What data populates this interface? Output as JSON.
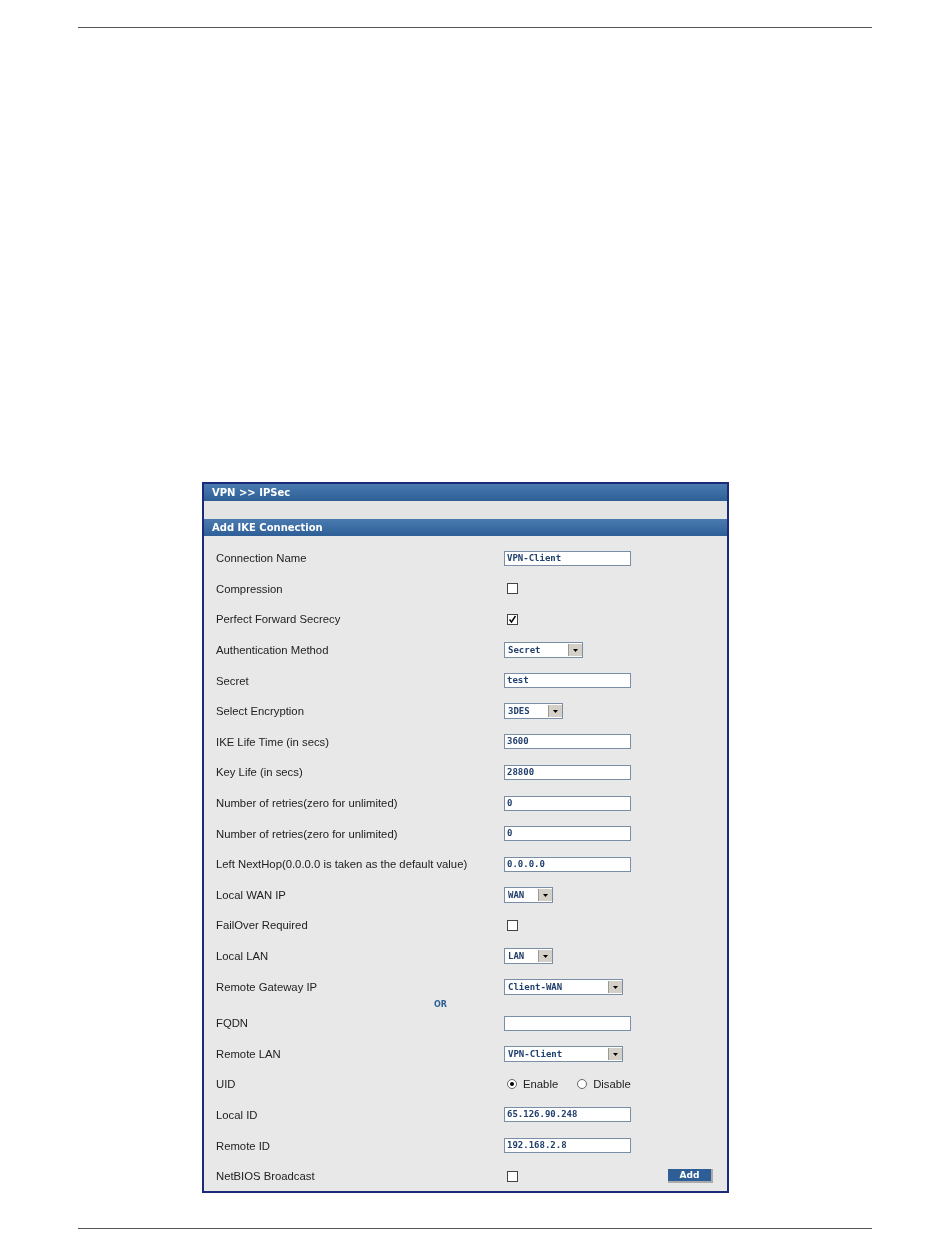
{
  "breadcrumb": "VPN >> IPSec",
  "section_title": "Add IKE Connection",
  "fields": [
    {
      "kind": "text",
      "label": "Connection Name",
      "value": "VPN-Client"
    },
    {
      "kind": "checkbox",
      "label": "Compression",
      "checked": false
    },
    {
      "kind": "checkbox",
      "label": "Perfect Forward Secrecy",
      "checked": true
    },
    {
      "kind": "select",
      "label": "Authentication Method",
      "value": "Secret"
    },
    {
      "kind": "text",
      "label": "Secret",
      "value": "test"
    },
    {
      "kind": "select",
      "label": "Select Encryption",
      "value": "3DES"
    },
    {
      "kind": "text",
      "label": "IKE Life Time (in secs)",
      "value": "3600"
    },
    {
      "kind": "text",
      "label": "Key Life (in secs)",
      "value": "28800"
    },
    {
      "kind": "text",
      "label": "Number of retries(zero for unlimited)",
      "value": "0"
    },
    {
      "kind": "text",
      "label": "Number of retries(zero for unlimited)",
      "value": "0"
    },
    {
      "kind": "text",
      "label": "Left NextHop(0.0.0.0 is taken as the default value)",
      "value": "0.0.0.0"
    },
    {
      "kind": "select",
      "label": "Local WAN IP",
      "value": "WAN"
    },
    {
      "kind": "checkbox",
      "label": "FailOver Required",
      "checked": false
    },
    {
      "kind": "select",
      "label": "Local LAN",
      "value": "LAN"
    },
    {
      "kind": "select",
      "label": "Remote Gateway IP",
      "value": "Client-WAN"
    },
    {
      "kind": "or",
      "label": "OR"
    },
    {
      "kind": "text",
      "label": "FQDN"
    },
    {
      "kind": "select",
      "label": "Remote LAN",
      "value": "VPN-Client"
    },
    {
      "kind": "radio",
      "label": "UID",
      "options": [
        {
          "label": "Enable",
          "selected": true
        },
        {
          "label": "Disable",
          "selected": false
        }
      ]
    },
    {
      "kind": "text",
      "label": "Local ID",
      "value": "65.126.90.248"
    },
    {
      "kind": "text",
      "label": "Remote ID",
      "value": "192.168.2.8"
    },
    {
      "kind": "checkbox",
      "label": "NetBIOS Broadcast",
      "checked": false
    }
  ],
  "add_button": "Add"
}
